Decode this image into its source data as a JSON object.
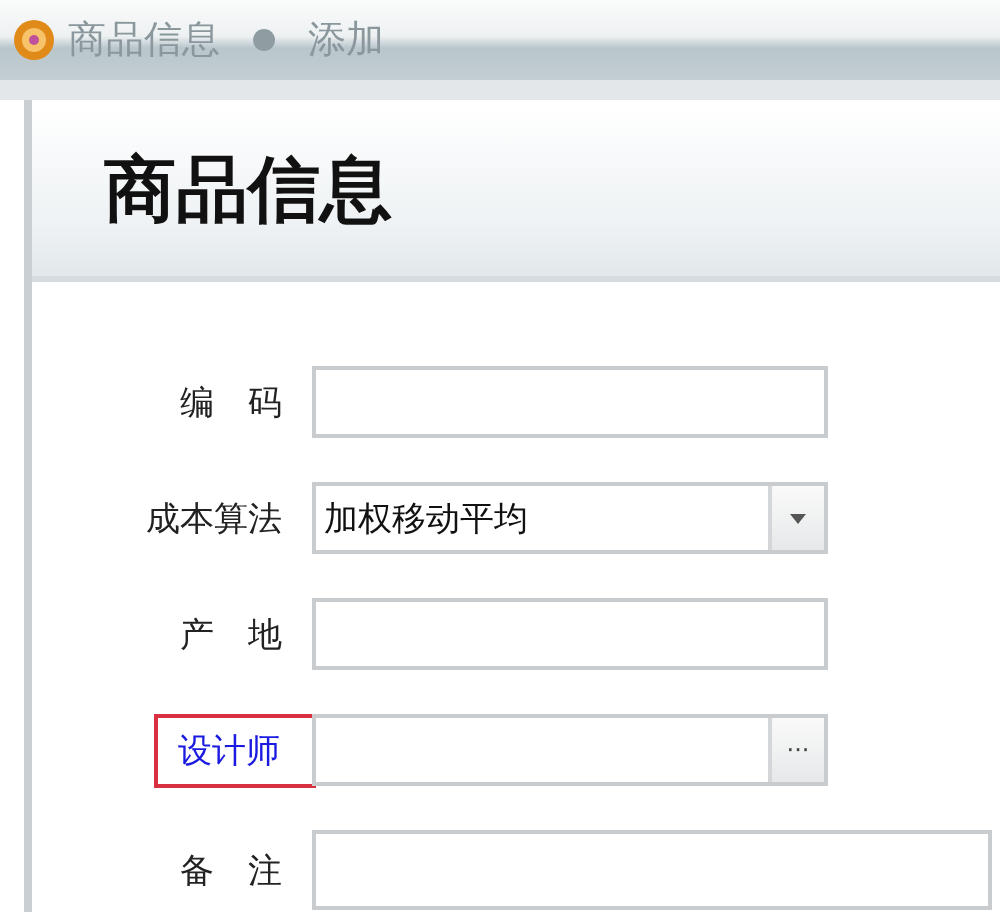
{
  "breadcrumb": [
    "商品信息",
    "添加"
  ],
  "title": "商品信息",
  "fields": [
    {
      "kind": "text",
      "label": "编　码",
      "link": false,
      "highlighted": false
    },
    {
      "kind": "select",
      "label": "成本算法",
      "value": "加权移动平均",
      "link": false,
      "highlighted": false
    },
    {
      "kind": "text",
      "label": "产　地",
      "link": false,
      "highlighted": false
    },
    {
      "kind": "lookup",
      "label": "设计师",
      "button": "···",
      "link": true,
      "highlighted": true
    },
    {
      "kind": "textarea",
      "label": "备　注",
      "link": false,
      "highlighted": false
    }
  ]
}
